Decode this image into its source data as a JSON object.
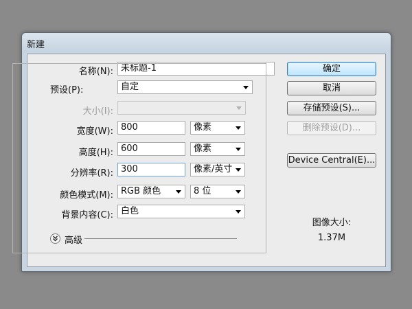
{
  "window": {
    "title": "新建"
  },
  "form": {
    "name": {
      "label": "名称(N):",
      "value": "未标题-1"
    },
    "preset": {
      "label": "预设(P):",
      "value": "自定"
    },
    "size": {
      "label": "大小(I):",
      "value": ""
    },
    "width": {
      "label": "宽度(W):",
      "value": "800",
      "unit": "像素"
    },
    "height": {
      "label": "高度(H):",
      "value": "600",
      "unit": "像素"
    },
    "resolution": {
      "label": "分辨率(R):",
      "value": "300",
      "unit": "像素/英寸"
    },
    "color_mode": {
      "label": "颜色模式(M):",
      "value": "RGB 颜色",
      "depth": "8 位"
    },
    "background": {
      "label": "背景内容(C):",
      "value": "白色"
    },
    "advanced": {
      "label": "高级"
    }
  },
  "buttons": {
    "ok": "确定",
    "cancel": "取消",
    "save_preset": "存储预设(S)...",
    "delete_preset": "删除预设(D)...",
    "device_central": "Device Central(E)..."
  },
  "image_size": {
    "label": "图像大小:",
    "value": "1.37M"
  },
  "icons": {
    "advanced_toggle": "chevron-double-down-icon",
    "dropdown": "triangle-down-icon"
  }
}
